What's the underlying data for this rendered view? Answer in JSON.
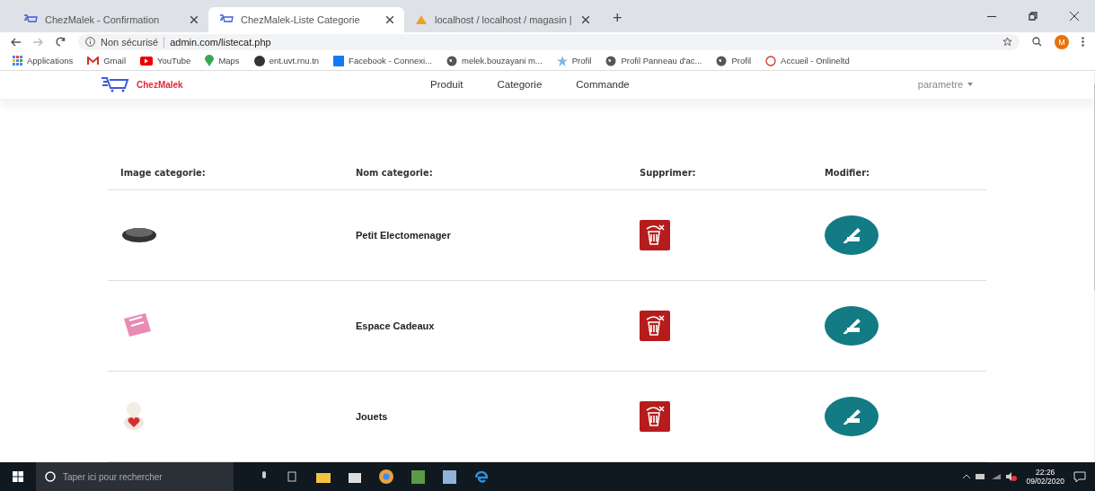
{
  "browser": {
    "tabs": [
      {
        "title": "ChezMalek - Confirmation",
        "selected": false,
        "kind": "cart"
      },
      {
        "title": "ChezMalek-Liste Categorie",
        "selected": true,
        "kind": "cart"
      },
      {
        "title": "localhost / localhost / magasin |",
        "selected": false,
        "kind": "db"
      }
    ],
    "new_tab": "+",
    "security": "Non sécurisé",
    "url": "admin.com/listecat.php",
    "avatar": "M",
    "bookmarks": [
      {
        "label": "Applications",
        "kind": "apps"
      },
      {
        "label": "Gmail",
        "kind": "mail"
      },
      {
        "label": "YouTube",
        "kind": "video"
      },
      {
        "label": "Maps",
        "kind": "pin"
      },
      {
        "label": "ent.uvt.rnu.tn",
        "kind": "circle"
      },
      {
        "label": "Facebook - Connexi...",
        "kind": "square"
      },
      {
        "label": "melek.bouzayani m...",
        "kind": "globe"
      },
      {
        "label": "Profil",
        "kind": "star"
      },
      {
        "label": "Profil Panneau d'ac...",
        "kind": "globe"
      },
      {
        "label": "Profil",
        "kind": "globe"
      },
      {
        "label": "Accueil - Onlineltd",
        "kind": "ring"
      }
    ]
  },
  "navbar": {
    "brand": "ChezMalek",
    "links": [
      "Produit",
      "Categorie",
      "Commande"
    ],
    "menu": "parametre"
  },
  "table": {
    "columns": [
      "Image categorie:",
      "Nom categorie:",
      "Supprimer:",
      "Modifier:"
    ],
    "rows": [
      {
        "kind": "appliance",
        "name": "Petit Electomenager"
      },
      {
        "kind": "gift",
        "name": "Espace Cadeaux"
      },
      {
        "kind": "toy",
        "name": "Jouets"
      }
    ]
  },
  "taskbar": {
    "search_placeholder": "Taper ici pour rechercher",
    "time": "22:26",
    "date": "09/02/2020"
  }
}
